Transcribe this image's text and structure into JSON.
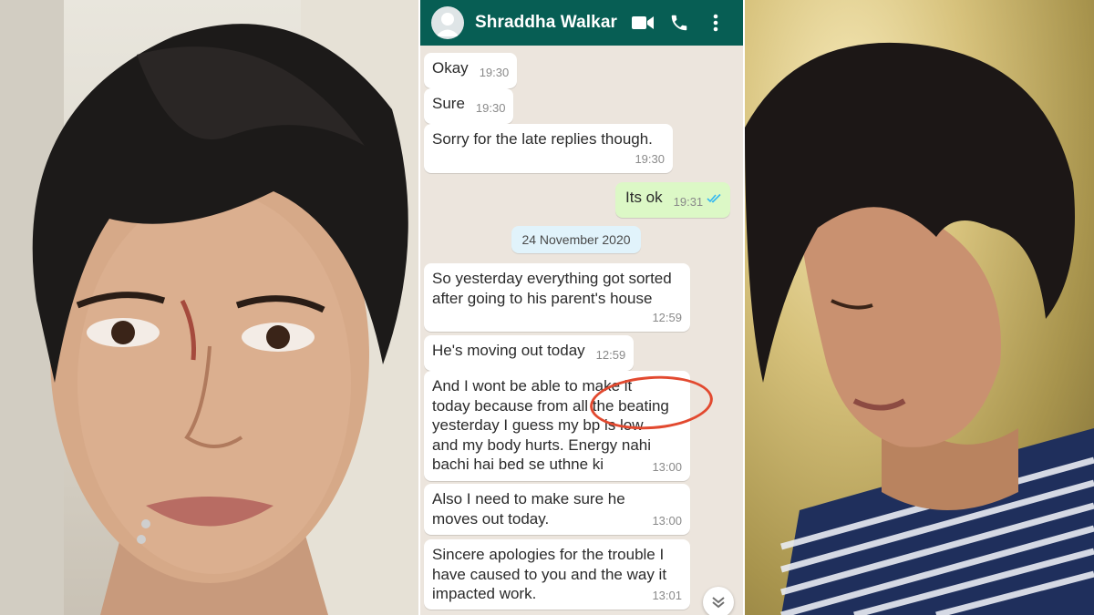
{
  "header": {
    "contact_name": "Shraddha Walkar",
    "icons": [
      "avatar-icon",
      "video-call-icon",
      "voice-call-icon",
      "more-options-icon"
    ],
    "bar_color": "#075e54"
  },
  "date_divider": "24 November 2020",
  "messages": [
    {
      "direction": "incoming",
      "text": "Okay",
      "time": "19:30"
    },
    {
      "direction": "incoming",
      "text": "Sure",
      "time": "19:30"
    },
    {
      "direction": "incoming",
      "text": "Sorry for the late replies though.",
      "time": "19:30"
    },
    {
      "direction": "outgoing",
      "text": "Its ok",
      "time": "19:31",
      "status": "read"
    },
    {
      "direction": "incoming",
      "text": "So yesterday everything got sorted\nafter going to his parent's house",
      "time": "12:59"
    },
    {
      "direction": "incoming",
      "text": "He's moving out today",
      "time": "12:59"
    },
    {
      "direction": "incoming",
      "text": "And I wont be able to make it\ntoday because from all the beating\nyesterday I guess my bp is low\nand my body hurts. Energy nahi\nbachi hai bed se uthne ki",
      "time": "13:00",
      "annotation": "the beating"
    },
    {
      "direction": "incoming",
      "text": "Also I need to make sure he\nmoves out today.",
      "time": "13:00"
    },
    {
      "direction": "incoming",
      "text": "Sincere apologies for the trouble I\nhave caused to you and the way it\nimpacted work.",
      "time": "13:01"
    }
  ],
  "colors": {
    "chat_background": "#ece5dd",
    "incoming_bubble": "#ffffff",
    "outgoing_bubble": "#dcf8c6",
    "annotation_circle": "#e2492f",
    "read_ticks": "#34b7f1"
  },
  "photos": {
    "left": "portrait-photo-with-facial-injuries",
    "right": "portrait-photo-in-striped-top"
  }
}
